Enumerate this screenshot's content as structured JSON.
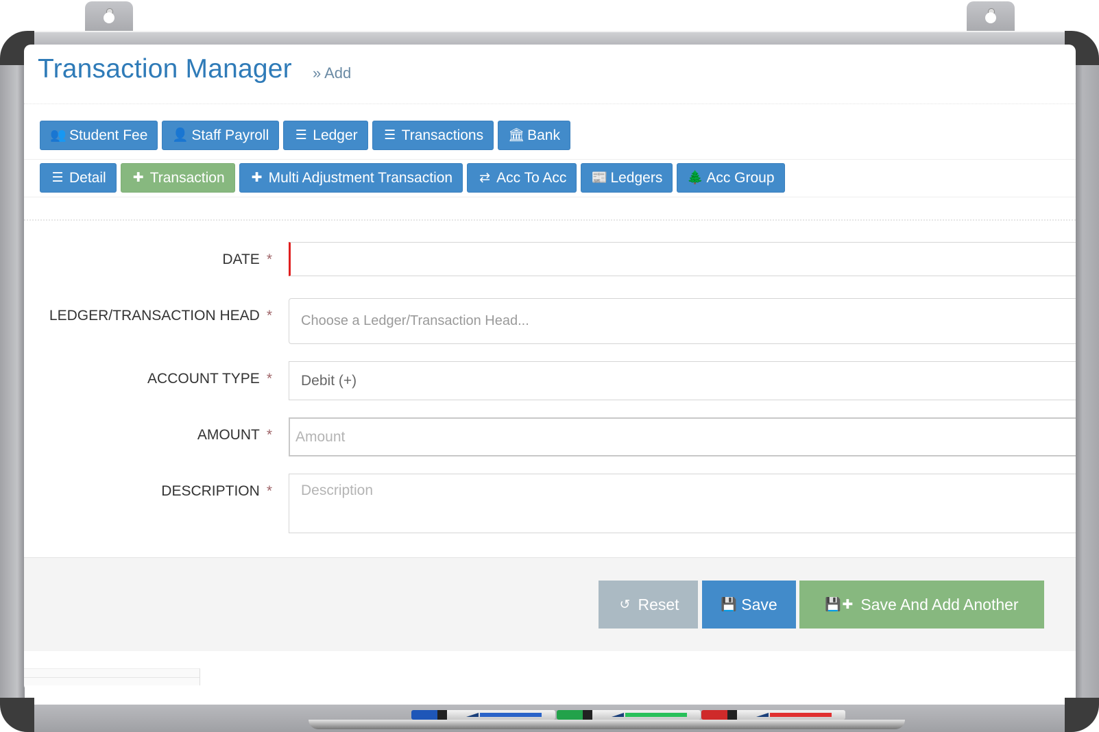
{
  "header": {
    "title": "Transaction Manager",
    "subtitle": "» Add"
  },
  "nav_row_1": [
    {
      "label": "Student Fee",
      "icon": "users-icon"
    },
    {
      "label": "Staff Payroll",
      "icon": "user-secret-icon"
    },
    {
      "label": "Ledger",
      "icon": "list-icon"
    },
    {
      "label": "Transactions",
      "icon": "list-icon"
    },
    {
      "label": "Bank",
      "icon": "bank-icon"
    }
  ],
  "nav_row_2": [
    {
      "label": "Detail",
      "icon": "list-icon"
    },
    {
      "label": "Transaction",
      "icon": "plus-icon",
      "active": true
    },
    {
      "label": "Multi Adjustment Transaction",
      "icon": "plus-icon"
    },
    {
      "label": "Acc To Acc",
      "icon": "exchange-icon"
    },
    {
      "label": "Ledgers",
      "icon": "newspaper-icon"
    },
    {
      "label": "Acc Group",
      "icon": "tree-icon"
    }
  ],
  "form": {
    "required_marker": "*",
    "date": {
      "label": "DATE",
      "value": ""
    },
    "ledger_head": {
      "label": "LEDGER/TRANSACTION HEAD",
      "placeholder": "Choose a Ledger/Transaction Head..."
    },
    "account_type": {
      "label": "ACCOUNT TYPE",
      "value": "Debit (+)"
    },
    "amount": {
      "label": "AMOUNT",
      "placeholder": "Amount"
    },
    "description": {
      "label": "DESCRIPTION",
      "placeholder": "Description"
    }
  },
  "actions": {
    "reset": "Reset",
    "save": "Save",
    "save_add": "Save And Add Another"
  },
  "colors": {
    "primary": "#428bca",
    "success": "#87b87f",
    "reset": "#abbac3",
    "title": "#2f7bb8",
    "required": "#a0666a",
    "date_focus": "#e02020"
  }
}
